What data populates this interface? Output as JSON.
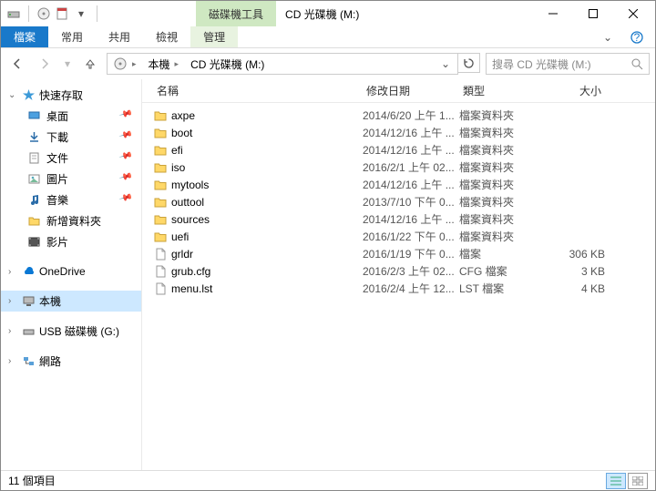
{
  "window": {
    "context_tab": "磁碟機工具",
    "title": "CD 光碟機 (M:)"
  },
  "ribbon": {
    "file": "檔案",
    "home": "常用",
    "share": "共用",
    "view": "檢視",
    "manage": "管理"
  },
  "address": {
    "root": "本機",
    "current": "CD 光碟機 (M:)",
    "search_placeholder": "搜尋 CD 光碟機 (M:)"
  },
  "nav": {
    "quick_access": "快速存取",
    "qa_items": [
      {
        "label": "桌面",
        "icon": "desktop"
      },
      {
        "label": "下載",
        "icon": "download"
      },
      {
        "label": "文件",
        "icon": "doc"
      },
      {
        "label": "圖片",
        "icon": "pic"
      },
      {
        "label": "音樂",
        "icon": "music"
      },
      {
        "label": "新增資料夾",
        "icon": "folder"
      },
      {
        "label": "影片",
        "icon": "video"
      }
    ],
    "onedrive": "OneDrive",
    "thispc": "本機",
    "usb": "USB 磁碟機 (G:)",
    "network": "網路"
  },
  "columns": {
    "name": "名稱",
    "date": "修改日期",
    "type": "類型",
    "size": "大小"
  },
  "files": [
    {
      "name": "axpe",
      "date": "2014/6/20 上午 1...",
      "type": "檔案資料夾",
      "size": "",
      "kind": "folder"
    },
    {
      "name": "boot",
      "date": "2014/12/16 上午 ...",
      "type": "檔案資料夾",
      "size": "",
      "kind": "folder"
    },
    {
      "name": "efi",
      "date": "2014/12/16 上午 ...",
      "type": "檔案資料夾",
      "size": "",
      "kind": "folder"
    },
    {
      "name": "iso",
      "date": "2016/2/1 上午 02...",
      "type": "檔案資料夾",
      "size": "",
      "kind": "folder"
    },
    {
      "name": "mytools",
      "date": "2014/12/16 上午 ...",
      "type": "檔案資料夾",
      "size": "",
      "kind": "folder"
    },
    {
      "name": "outtool",
      "date": "2013/7/10 下午 0...",
      "type": "檔案資料夾",
      "size": "",
      "kind": "folder"
    },
    {
      "name": "sources",
      "date": "2014/12/16 上午 ...",
      "type": "檔案資料夾",
      "size": "",
      "kind": "folder"
    },
    {
      "name": "uefi",
      "date": "2016/1/22 下午 0...",
      "type": "檔案資料夾",
      "size": "",
      "kind": "folder"
    },
    {
      "name": "grldr",
      "date": "2016/1/19 下午 0...",
      "type": "檔案",
      "size": "306 KB",
      "kind": "file"
    },
    {
      "name": "grub.cfg",
      "date": "2016/2/3 上午 02...",
      "type": "CFG 檔案",
      "size": "3 KB",
      "kind": "file"
    },
    {
      "name": "menu.lst",
      "date": "2016/2/4 上午 12...",
      "type": "LST 檔案",
      "size": "4 KB",
      "kind": "file"
    }
  ],
  "status": "11 個項目"
}
